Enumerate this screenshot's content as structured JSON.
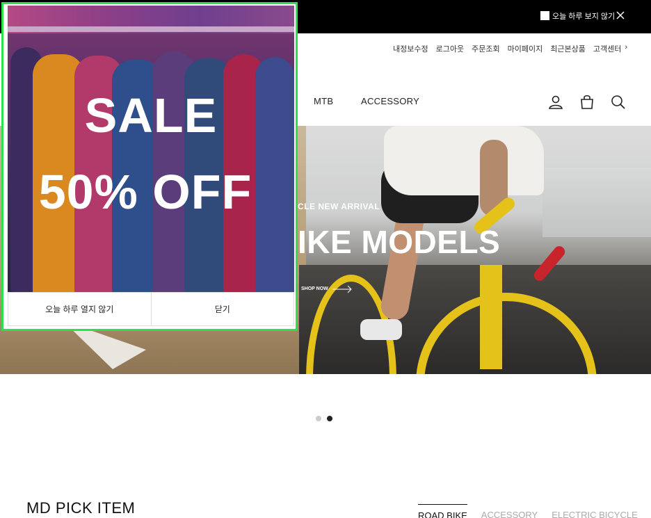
{
  "topbar": {
    "hide_today_label": "오늘 하루 보지 않기"
  },
  "utility_links": [
    "내정보수정",
    "로그아웃",
    "주문조회",
    "마이페이지",
    "최근본상품",
    "고객센터"
  ],
  "nav": {
    "mtb": "MTB",
    "accessory": "ACCESSORY"
  },
  "hero": {
    "subtitle": "CLE NEW ARRIVAL",
    "title": "IKE MODELS",
    "cta": "SHOP NOW"
  },
  "slider": {
    "total": 2,
    "active": 2
  },
  "section": {
    "title": "MD PICK ITEM",
    "tabs": [
      "ROAD BIKE",
      "ACCESSORY",
      "ELECTRIC BICYCLE"
    ],
    "active_tab": "ROAD BIKE"
  },
  "popup": {
    "line1": "SALE",
    "line2": "50% OFF",
    "dont_show_today": "오늘 하루 열지 않기",
    "close": "닫기"
  },
  "colors": {
    "popup_border": "#2ee04c",
    "topbar": "#000000",
    "bike_yellow": "#e5c21a"
  },
  "icons": [
    "close-icon",
    "user-icon",
    "cart-icon",
    "search-icon",
    "arrow-right-icon"
  ]
}
